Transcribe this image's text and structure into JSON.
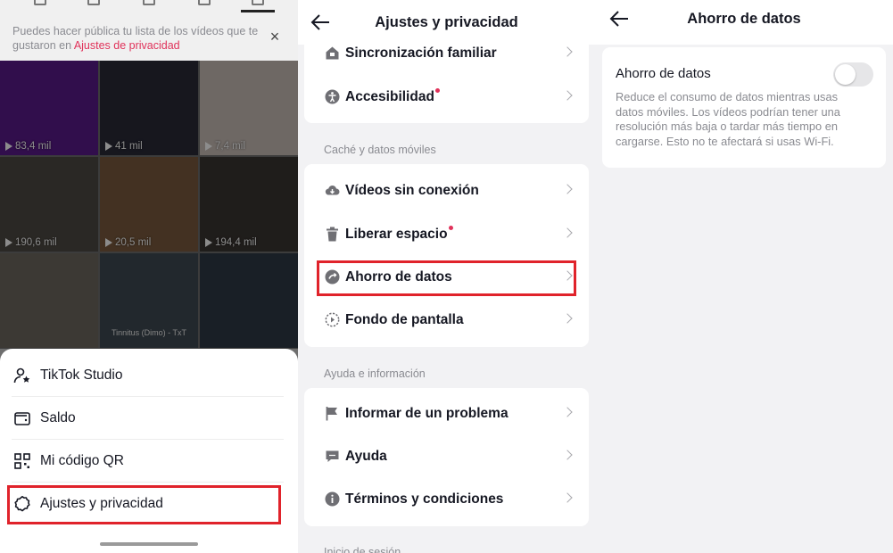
{
  "profile_panel": {
    "notice_text": "Puedes hacer pública tu lista de los vídeos que te gustaron en ",
    "notice_link": "Ajustes de privacidad",
    "videos": [
      {
        "views": "83,4 mil",
        "bg": "#5a1a8a",
        "caption": ""
      },
      {
        "views": "41 mil",
        "bg": "#2a2a38",
        "caption": ""
      },
      {
        "views": "7,4 mil",
        "bg": "#c8bdb6",
        "caption": ""
      },
      {
        "views": "190,6 mil",
        "bg": "#4e4a44",
        "caption": ""
      },
      {
        "views": "20,5 mil",
        "bg": "#7a5a3e",
        "caption": ""
      },
      {
        "views": "194,4 mil",
        "bg": "#3a3532",
        "caption": ""
      },
      {
        "views": "",
        "bg": "#6d6860",
        "caption": ""
      },
      {
        "views": "",
        "bg": "#3f4a52",
        "caption": "Tinnitus (Dimo) - TxT"
      },
      {
        "views": "",
        "bg": "#2e3a46",
        "caption": ""
      }
    ],
    "menu": [
      {
        "label": "TikTok Studio",
        "icon": "person-star-icon"
      },
      {
        "label": "Saldo",
        "icon": "wallet-icon"
      },
      {
        "label": "Mi código QR",
        "icon": "qr-code-icon"
      },
      {
        "label": "Ajustes y privacidad",
        "icon": "settings-icon"
      }
    ]
  },
  "settings_panel": {
    "title": "Ajustes y privacidad",
    "group1": [
      {
        "label": "Sincronización familiar",
        "icon": "home-lock-icon",
        "dot": false
      },
      {
        "label": "Accesibilidad",
        "icon": "accessibility-icon",
        "dot": true
      }
    ],
    "section_cache": "Caché y datos móviles",
    "group2": [
      {
        "label": "Vídeos sin conexión",
        "icon": "cloud-download-icon",
        "dot": false
      },
      {
        "label": "Liberar espacio",
        "icon": "trash-icon",
        "dot": true
      },
      {
        "label": "Ahorro de datos",
        "icon": "data-saver-icon",
        "dot": false
      },
      {
        "label": "Fondo de pantalla",
        "icon": "wallpaper-icon",
        "dot": false
      }
    ],
    "section_help": "Ayuda e información",
    "group3": [
      {
        "label": "Informar de un problema",
        "icon": "flag-icon",
        "dot": false
      },
      {
        "label": "Ayuda",
        "icon": "chat-bubble-icon",
        "dot": false
      },
      {
        "label": "Términos y condiciones",
        "icon": "info-icon",
        "dot": false
      }
    ],
    "section_login": "Inicio de sesión"
  },
  "data_saver_panel": {
    "title": "Ahorro de datos",
    "setting_label": "Ahorro de datos",
    "enabled": false,
    "description": "Reduce el consumo de datos mientras usas datos móviles. Los vídeos podrían tener una resolución más baja o tardar más tiempo en cargarse. Esto no te afectará si usas Wi-Fi."
  },
  "colors": {
    "highlight": "#e0232b",
    "accent_link": "#e0325a",
    "background": "#f2f2f4"
  }
}
